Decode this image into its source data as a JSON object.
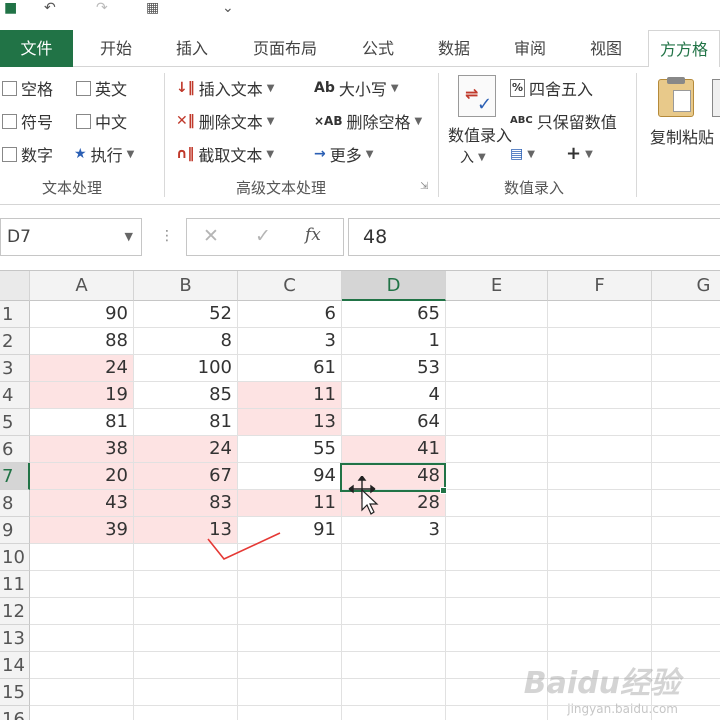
{
  "ribbon_tabs": [
    {
      "label": "文件"
    },
    {
      "label": "开始"
    },
    {
      "label": "插入"
    },
    {
      "label": "页面布局"
    },
    {
      "label": "公式"
    },
    {
      "label": "数据"
    },
    {
      "label": "审阅"
    },
    {
      "label": "视图"
    },
    {
      "label": "方方格"
    }
  ],
  "ribbon": {
    "text_group": {
      "label": "文本处理",
      "items": [
        "空格",
        "英文",
        "符号",
        "中文",
        "数字",
        "执行"
      ]
    },
    "advanced_group": {
      "label": "高级文本处理",
      "items": [
        "插入文本",
        "删除文本",
        "截取文本",
        "大小写",
        "删除空格",
        "更多"
      ]
    },
    "entry_group": {
      "label": "数值录入",
      "big_button": "数值录入",
      "items": [
        "四舍五入",
        "只保留数值"
      ]
    },
    "paste": {
      "label": "复制粘贴"
    }
  },
  "formula_bar": {
    "name_box": "D7",
    "formula_value": "48"
  },
  "columns": [
    "A",
    "B",
    "C",
    "D",
    "E",
    "F",
    "G"
  ],
  "rows": [
    "1",
    "2",
    "3",
    "4",
    "5",
    "6",
    "7",
    "8",
    "9",
    "10",
    "11",
    "12",
    "13",
    "14",
    "15",
    "16"
  ],
  "cells": [
    [
      "90",
      "52",
      "6",
      "65"
    ],
    [
      "88",
      "8",
      "3",
      "1"
    ],
    [
      "24",
      "100",
      "61",
      "53"
    ],
    [
      "19",
      "85",
      "11",
      "4"
    ],
    [
      "81",
      "81",
      "13",
      "64"
    ],
    [
      "38",
      "24",
      "55",
      "41"
    ],
    [
      "20",
      "67",
      "94",
      "48"
    ],
    [
      "43",
      "83",
      "11",
      "28"
    ],
    [
      "39",
      "13",
      "91",
      "3"
    ]
  ],
  "watermark": {
    "text": "Baidu经验",
    "sub": "jingyan.baidu.com"
  },
  "colors": {
    "accent": "#217346",
    "highlight": "#fde3e3"
  }
}
